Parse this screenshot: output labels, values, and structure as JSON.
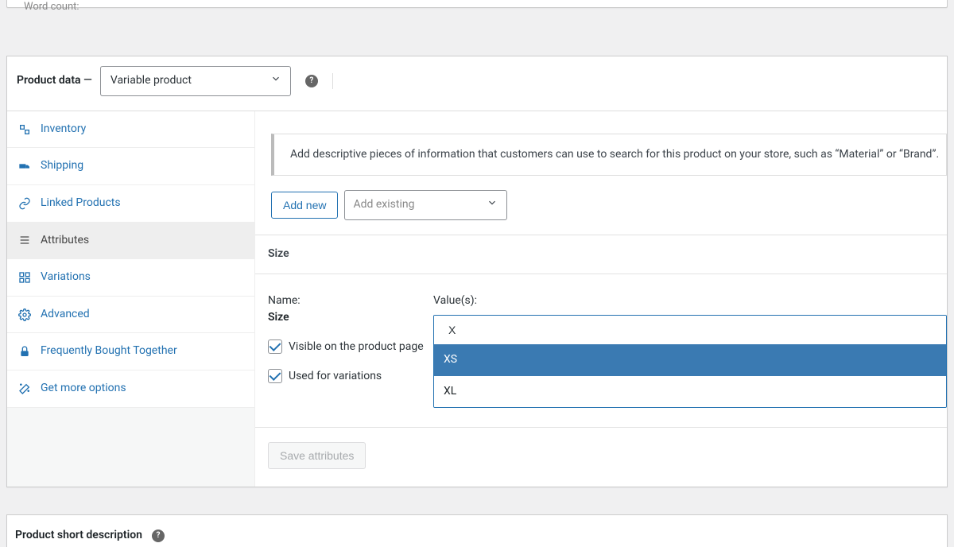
{
  "word_count_prefix": "Word count:",
  "product_data_title": "Product data",
  "dash": " — ",
  "product_type_select": "Variable product",
  "tabs": {
    "inventory": "Inventory",
    "shipping": "Shipping",
    "linked_products": "Linked Products",
    "attributes": "Attributes",
    "variations": "Variations",
    "advanced": "Advanced",
    "fbt": "Frequently Bought Together",
    "get_more": "Get more options"
  },
  "hint_text": "Add descriptive pieces of information that customers can use to search for this product on your store, such as “Material” or “Brand”.",
  "add_new_label": "Add new",
  "add_existing_placeholder": "Add existing",
  "attribute": {
    "header": "Size",
    "name_label": "Name:",
    "name_value": "Size",
    "visible_label": "Visible on the product page",
    "used_variations_label": "Used for variations",
    "values_label": "Value(s):",
    "search_value": "X",
    "options": {
      "xs": "XS",
      "xl": "XL"
    }
  },
  "save_attributes_label": "Save attributes",
  "short_desc_title": "Product short description"
}
